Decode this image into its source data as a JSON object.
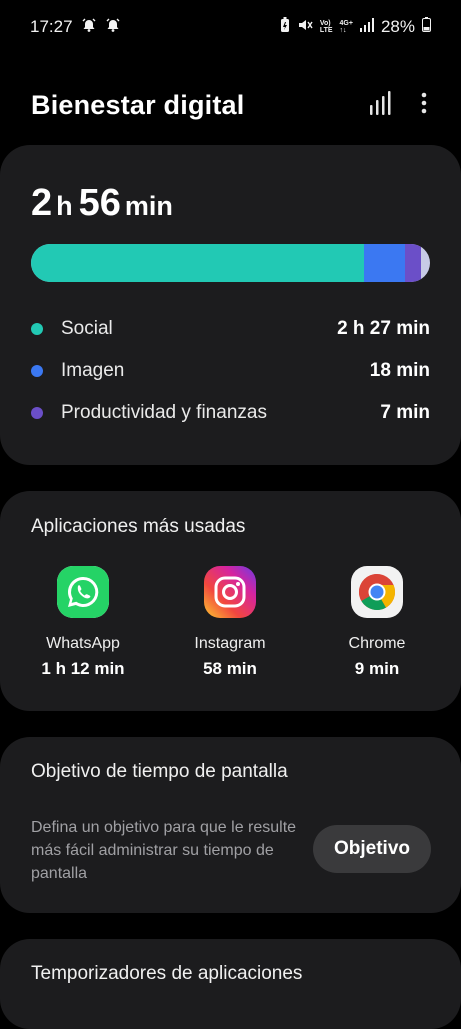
{
  "status_bar": {
    "time": "17:27",
    "battery": "28%",
    "volte": "Vo)",
    "lte": "LTE",
    "network": "4G+"
  },
  "header": {
    "title": "Bienestar digital"
  },
  "usage": {
    "hours": "2",
    "hours_unit": "h",
    "minutes": "56",
    "minutes_unit": "min",
    "categories": [
      {
        "label": "Social",
        "value": "2 h 27 min",
        "color": "#22c9b4",
        "fraction": 0.835
      },
      {
        "label": "Imagen",
        "value": "18 min",
        "color": "#3b78f2",
        "fraction": 0.102
      },
      {
        "label": "Productividad y finanzas",
        "value": "7 min",
        "color": "#6b4fc8",
        "fraction": 0.04
      }
    ],
    "remainder_color": "#c7cbe6"
  },
  "apps": {
    "title": "Aplicaciones más usadas",
    "items": [
      {
        "name": "WhatsApp",
        "time": "1 h 12 min",
        "icon": "whatsapp-icon"
      },
      {
        "name": "Instagram",
        "time": "58 min",
        "icon": "instagram-icon"
      },
      {
        "name": "Chrome",
        "time": "9 min",
        "icon": "chrome-icon"
      }
    ]
  },
  "goal": {
    "title": "Objetivo de tiempo de pantalla",
    "description": "Defina un objetivo para que le resulte más fácil administrar su tiempo de pantalla",
    "button": "Objetivo"
  },
  "timers": {
    "title": "Temporizadores de aplicaciones"
  }
}
